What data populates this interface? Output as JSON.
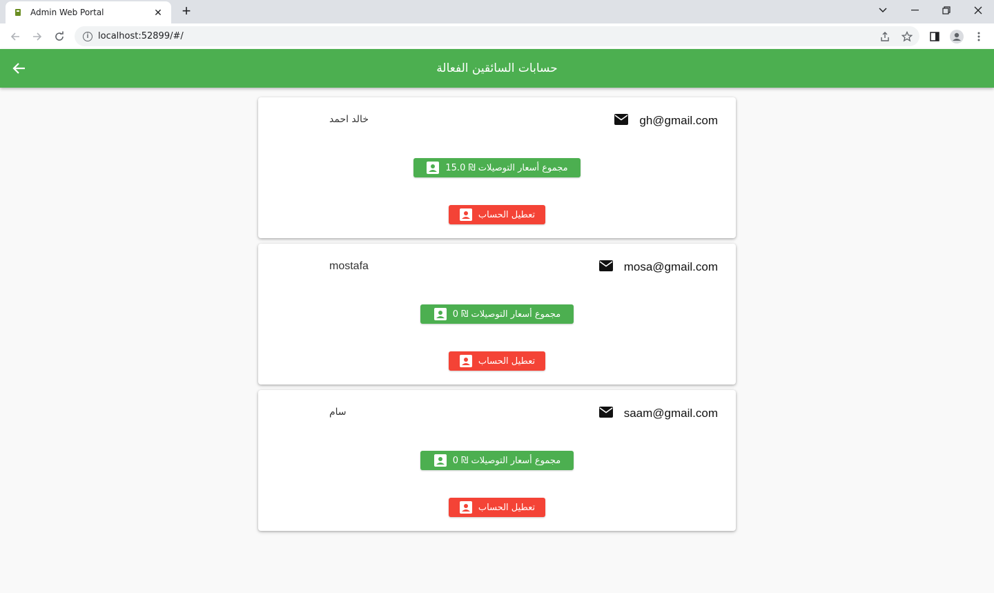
{
  "browser": {
    "tab_title": "Admin Web Portal",
    "tab_close": "✕",
    "new_tab": "+",
    "url": "localhost:52899/#/"
  },
  "appbar": {
    "title": "حسابات السائقين الفعالة",
    "color": "#4caf50"
  },
  "cards": [
    {
      "email": "gh@gmail.com",
      "name": "خالد احمد",
      "total_label": "مجموع أسعار التوصيلات ₪ 15.0",
      "disable_label": "تعطيل الحساب"
    },
    {
      "email": "mosa@gmail.com",
      "name": "mostafa",
      "total_label": "مجموع أسعار التوصيلات ₪ 0",
      "disable_label": "تعطيل الحساب"
    },
    {
      "email": "saam@gmail.com",
      "name": "سام",
      "total_label": "مجموع أسعار التوصيلات ₪ 0",
      "disable_label": "تعطيل الحساب"
    }
  ],
  "colors": {
    "green": "#4caf50",
    "red": "#f44336"
  }
}
